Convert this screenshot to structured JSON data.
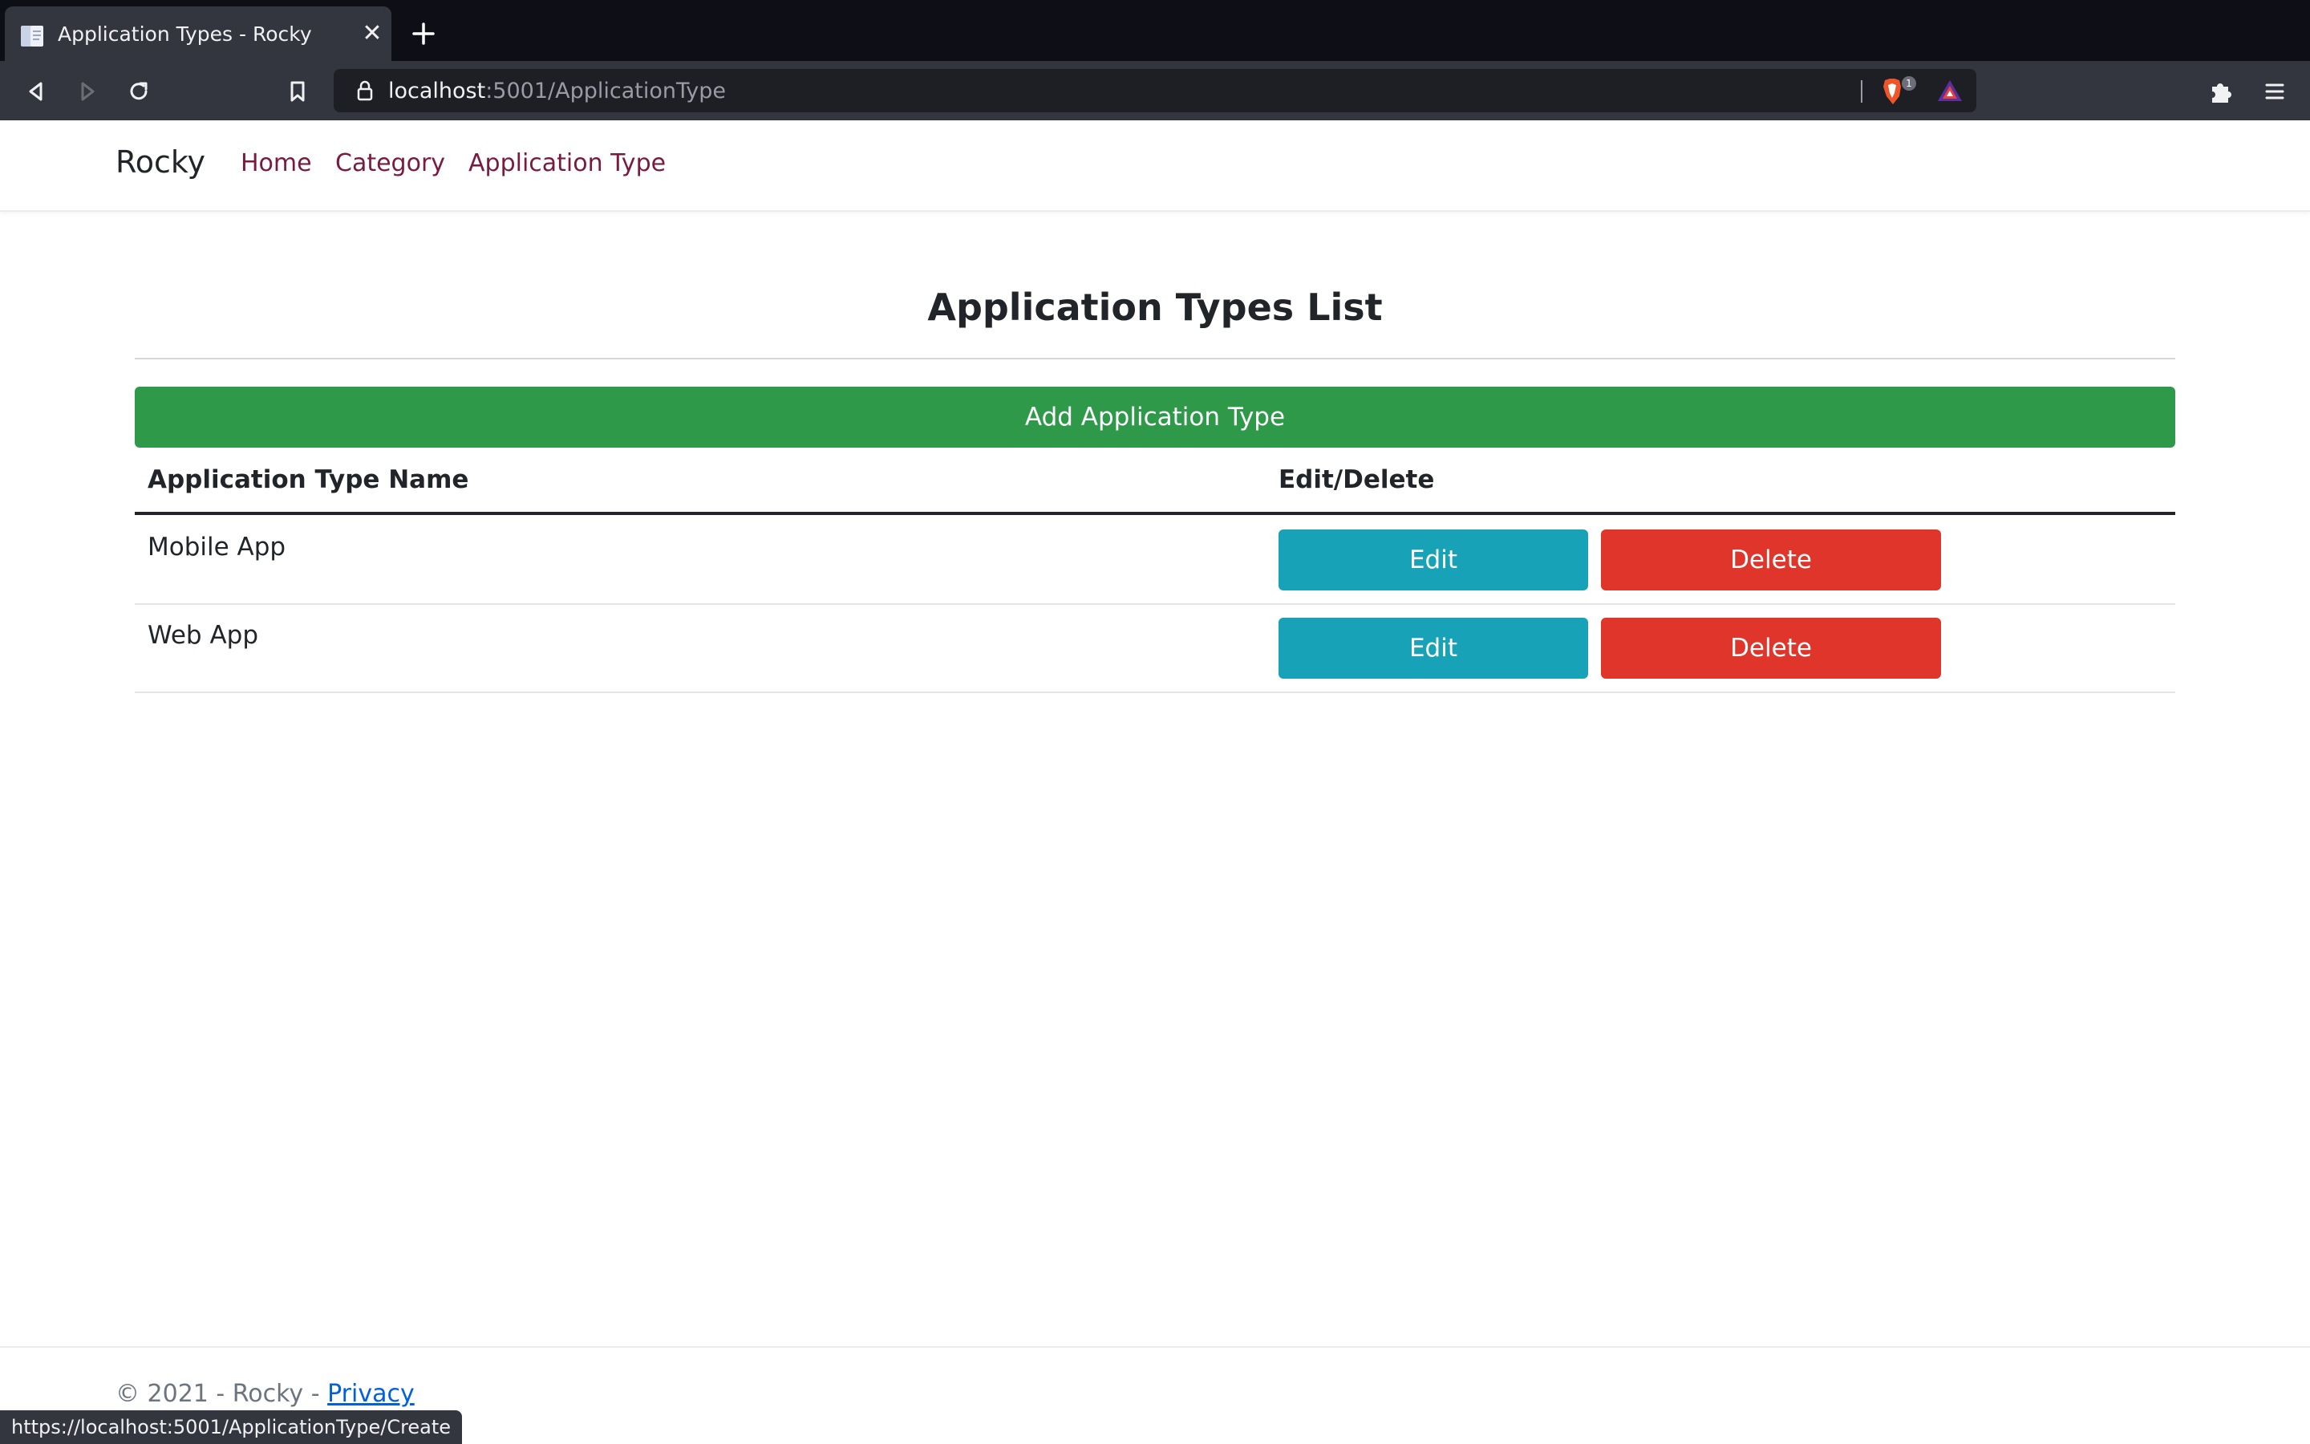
{
  "browser": {
    "tab_title": "Application Types - Rocky",
    "url_host": "localhost",
    "url_rest": ":5001/ApplicationType",
    "shield_count": "1",
    "status_url": "https://localhost:5001/ApplicationType/Create"
  },
  "navbar": {
    "brand": "Rocky",
    "links": [
      "Home",
      "Category",
      "Application Type"
    ],
    "link_color": "#7a1a3e"
  },
  "main": {
    "title": "Application Types List",
    "add_button": "Add Application Type",
    "columns": [
      "Application Type Name",
      "Edit/Delete"
    ],
    "rows": [
      {
        "name": "Mobile App",
        "edit": "Edit",
        "delete": "Delete"
      },
      {
        "name": "Web App",
        "edit": "Edit",
        "delete": "Delete"
      }
    ],
    "colors": {
      "add": "#2e9a49",
      "edit": "#17a2b8",
      "delete": "#e0352b"
    }
  },
  "footer": {
    "text": "© 2021 - Rocky - ",
    "privacy": "Privacy"
  }
}
